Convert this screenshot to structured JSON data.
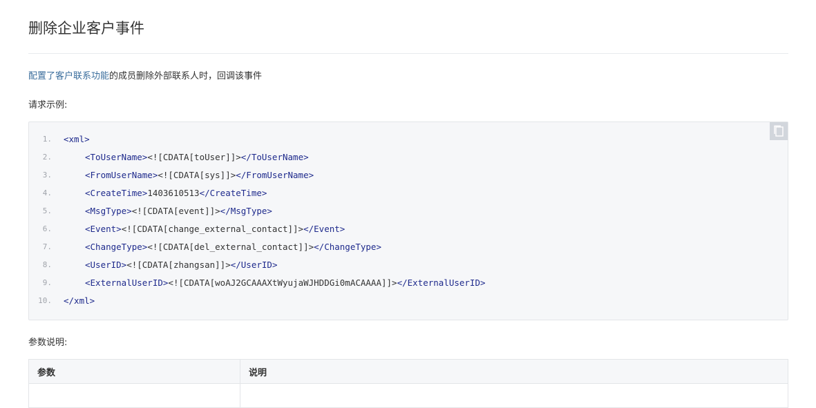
{
  "page": {
    "title": "删除企业客户事件",
    "description_link": "配置了客户联系功能",
    "description_rest": "的成员删除外部联系人时，回调该事件",
    "request_example_label": "请求示例:",
    "params_label": "参数说明:"
  },
  "code": {
    "copy_icon": "copy-icon",
    "lines": [
      {
        "num": "1.",
        "indent": 0,
        "open": "<xml>",
        "text": "",
        "close": ""
      },
      {
        "num": "2.",
        "indent": 1,
        "open": "<ToUserName>",
        "text": "<![CDATA[toUser]]>",
        "close": "</ToUserName>"
      },
      {
        "num": "3.",
        "indent": 1,
        "open": "<FromUserName>",
        "text": "<![CDATA[sys]]>",
        "close": "</FromUserName>"
      },
      {
        "num": "4.",
        "indent": 1,
        "open": "<CreateTime>",
        "text": "1403610513",
        "close": "</CreateTime>"
      },
      {
        "num": "5.",
        "indent": 1,
        "open": "<MsgType>",
        "text": "<![CDATA[event]]>",
        "close": "</MsgType>"
      },
      {
        "num": "6.",
        "indent": 1,
        "open": "<Event>",
        "text": "<![CDATA[change_external_contact]]>",
        "close": "</Event>"
      },
      {
        "num": "7.",
        "indent": 1,
        "open": "<ChangeType>",
        "text": "<![CDATA[del_external_contact]]>",
        "close": "</ChangeType>"
      },
      {
        "num": "8.",
        "indent": 1,
        "open": "<UserID>",
        "text": "<![CDATA[zhangsan]]>",
        "close": "</UserID>"
      },
      {
        "num": "9.",
        "indent": 1,
        "open": "<ExternalUserID>",
        "text": "<![CDATA[woAJ2GCAAAXtWyujaWJHDDGi0mACAAAA]]>",
        "close": "</ExternalUserID>"
      },
      {
        "num": "10.",
        "indent": 0,
        "open": "</xml>",
        "text": "",
        "close": ""
      }
    ]
  },
  "table": {
    "headers": [
      "参数",
      "说明"
    ]
  },
  "colors": {
    "link": "#3a6d9c",
    "tag": "#1e2a8c",
    "code_bg": "#f6f7f9"
  }
}
